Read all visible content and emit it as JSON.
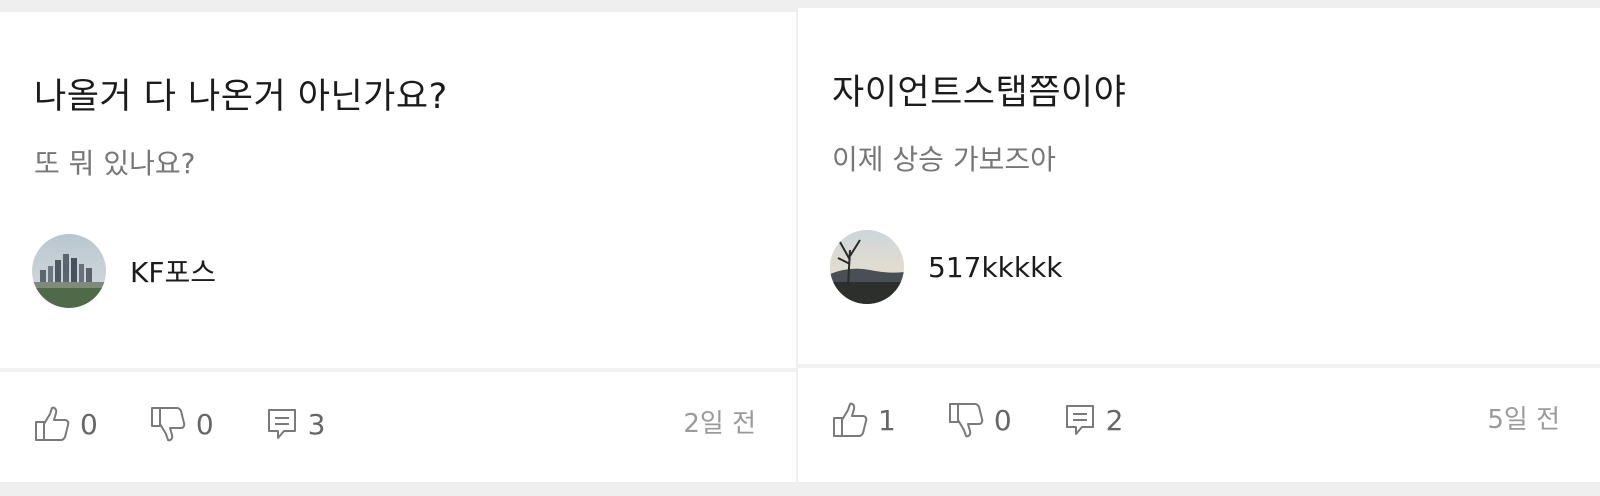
{
  "posts": [
    {
      "title": "나올거 다 나온거 아닌가요?",
      "body": "또 뭐 있나요?",
      "author": "KF포스",
      "likes": "0",
      "dislikes": "0",
      "comments": "3",
      "time": "2일 전"
    },
    {
      "title": "자이언트스탭쯤이야",
      "body": "이제 상승 가보즈아",
      "author": "517kkkkk",
      "likes": "1",
      "dislikes": "0",
      "comments": "2",
      "time": "5일 전"
    }
  ],
  "icons": {
    "like": "thumbs-up-icon",
    "dislike": "thumbs-down-icon",
    "comment": "comment-icon"
  },
  "colors": {
    "icon_stroke": "#7a7a7a",
    "title": "#1b1b1b",
    "body": "#777777",
    "time": "#9a9a9a"
  }
}
